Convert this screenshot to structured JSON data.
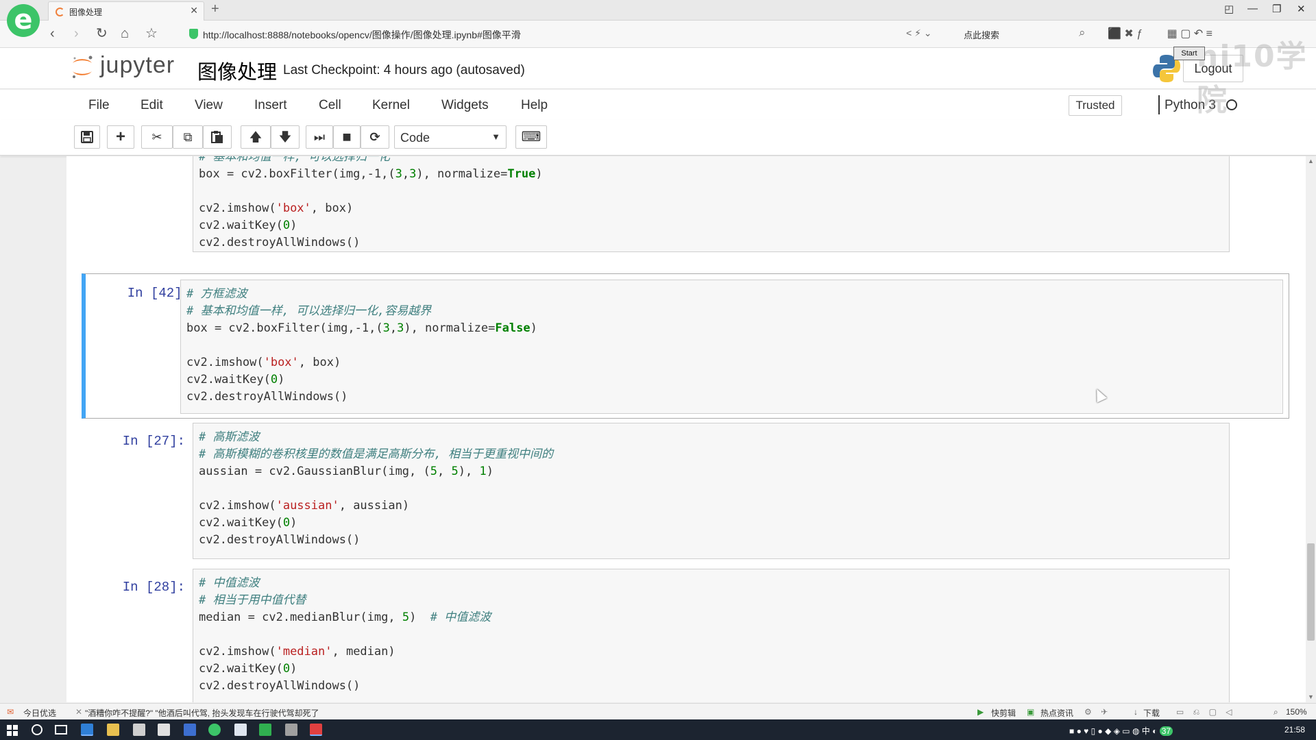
{
  "browser": {
    "tab_title": "图像处理",
    "tab_close": "✕",
    "new_tab": "+",
    "url": "http://localhost:8888/notebooks/opencv/图像操作/图像处理.ipynb#图像平滑",
    "search_placeholder": "点此搜索",
    "window_controls": [
      "◰",
      "—",
      "❐",
      "✕"
    ]
  },
  "jupyter": {
    "logo_text": "jupyter",
    "notebook_title": "图像处理",
    "checkpoint": "Last Checkpoint: 4 hours ago (autosaved)",
    "logout": "Logout",
    "start": "Start",
    "watermark": "ni10学院",
    "trusted": "Trusted",
    "kernel": "Python 3",
    "cell_type": "Code"
  },
  "menu": [
    "File",
    "Edit",
    "View",
    "Insert",
    "Cell",
    "Kernel",
    "Widgets",
    "Help"
  ],
  "toolbar": {
    "save_icon": "save-icon",
    "insert_icon": "+",
    "cut_icon": "✂",
    "copy_icon": "⧉",
    "paste_icon": "📋",
    "up_icon": "🡅",
    "down_icon": "🡇",
    "run_icon": "⏭",
    "stop_icon": "■",
    "restart_icon": "⟳",
    "dropdown_icon": "▼",
    "keyboard_icon": "⌨"
  },
  "cells": [
    {
      "prompt": "",
      "lines": [
        [
          {
            "t": "# 基本和均值一样, 可以选择归一化",
            "c": "cmt"
          }
        ],
        [
          {
            "t": "box = cv2.boxFilter(img,-1,(",
            "c": ""
          },
          {
            "t": "3",
            "c": "num"
          },
          {
            "t": ",",
            "c": ""
          },
          {
            "t": "3",
            "c": "num"
          },
          {
            "t": "), normalize=",
            "c": ""
          },
          {
            "t": "True",
            "c": "kw"
          },
          {
            "t": ")",
            "c": ""
          }
        ],
        [
          {
            "t": "",
            "c": ""
          }
        ],
        [
          {
            "t": "cv2.imshow(",
            "c": ""
          },
          {
            "t": "'box'",
            "c": "str"
          },
          {
            "t": ", box)",
            "c": ""
          }
        ],
        [
          {
            "t": "cv2.waitKey(",
            "c": ""
          },
          {
            "t": "0",
            "c": "num"
          },
          {
            "t": ")",
            "c": ""
          }
        ],
        [
          {
            "t": "cv2.destroyAllWindows()",
            "c": ""
          }
        ]
      ]
    },
    {
      "prompt": "In [42]:",
      "lines": [
        [
          {
            "t": "# 方框滤波",
            "c": "cmt"
          }
        ],
        [
          {
            "t": "# 基本和均值一样, 可以选择归一化,容易越界",
            "c": "cmt"
          }
        ],
        [
          {
            "t": "box = cv2.boxFilter(img,-1,(",
            "c": ""
          },
          {
            "t": "3",
            "c": "num"
          },
          {
            "t": ",",
            "c": ""
          },
          {
            "t": "3",
            "c": "num"
          },
          {
            "t": "), normalize=",
            "c": ""
          },
          {
            "t": "False",
            "c": "kw"
          },
          {
            "t": ")",
            "c": ""
          }
        ],
        [
          {
            "t": "",
            "c": ""
          }
        ],
        [
          {
            "t": "cv2.imshow(",
            "c": ""
          },
          {
            "t": "'box'",
            "c": "str"
          },
          {
            "t": ", box)",
            "c": ""
          }
        ],
        [
          {
            "t": "cv2.waitKey(",
            "c": ""
          },
          {
            "t": "0",
            "c": "num"
          },
          {
            "t": ")",
            "c": ""
          }
        ],
        [
          {
            "t": "cv2.destroyAllWindows()",
            "c": ""
          }
        ]
      ]
    },
    {
      "prompt": "In [27]:",
      "lines": [
        [
          {
            "t": "# 高斯滤波",
            "c": "cmt"
          }
        ],
        [
          {
            "t": "# 高斯模糊的卷积核里的数值是满足高斯分布, 相当于更重视中间的",
            "c": "cmt"
          }
        ],
        [
          {
            "t": "aussian = cv2.GaussianBlur(img, (",
            "c": ""
          },
          {
            "t": "5",
            "c": "num"
          },
          {
            "t": ", ",
            "c": ""
          },
          {
            "t": "5",
            "c": "num"
          },
          {
            "t": "), ",
            "c": ""
          },
          {
            "t": "1",
            "c": "num"
          },
          {
            "t": ")",
            "c": ""
          }
        ],
        [
          {
            "t": "",
            "c": ""
          }
        ],
        [
          {
            "t": "cv2.imshow(",
            "c": ""
          },
          {
            "t": "'aussian'",
            "c": "str"
          },
          {
            "t": ", aussian)",
            "c": ""
          }
        ],
        [
          {
            "t": "cv2.waitKey(",
            "c": ""
          },
          {
            "t": "0",
            "c": "num"
          },
          {
            "t": ")",
            "c": ""
          }
        ],
        [
          {
            "t": "cv2.destroyAllWindows()",
            "c": ""
          }
        ]
      ]
    },
    {
      "prompt": "In [28]:",
      "lines": [
        [
          {
            "t": "# 中值滤波",
            "c": "cmt"
          }
        ],
        [
          {
            "t": "# 相当于用中值代替",
            "c": "cmt"
          }
        ],
        [
          {
            "t": "median = cv2.medianBlur(img, ",
            "c": ""
          },
          {
            "t": "5",
            "c": "num"
          },
          {
            "t": ")  ",
            "c": ""
          },
          {
            "t": "# 中值滤波",
            "c": "cmt"
          }
        ],
        [
          {
            "t": "",
            "c": ""
          }
        ],
        [
          {
            "t": "cv2.imshow(",
            "c": ""
          },
          {
            "t": "'median'",
            "c": "str"
          },
          {
            "t": ", median)",
            "c": ""
          }
        ],
        [
          {
            "t": "cv2.waitKey(",
            "c": ""
          },
          {
            "t": "0",
            "c": "num"
          },
          {
            "t": ")",
            "c": ""
          }
        ],
        [
          {
            "t": "cv2.destroyAllWindows()",
            "c": ""
          }
        ]
      ]
    }
  ],
  "statusbar": {
    "left_label": "今日优选",
    "news": "\"酒糟你咋不提醒?\" \"他酒后叫代驾, 抬头发现车在行驶代驾却死了",
    "right_items": [
      "快剪辑",
      "热点资讯",
      "下载",
      "150%"
    ]
  },
  "taskbar": {
    "clock": "21:58",
    "tray_text": "中",
    "tray_badge": "37"
  },
  "colors": {
    "accent_selected": "#42a5f5",
    "prompt": "#303f9f",
    "comment": "#408080",
    "keyword": "#008000",
    "string": "#ba2121",
    "browser_logo": "#3cc468",
    "jupyter_orange": "#f37726"
  }
}
